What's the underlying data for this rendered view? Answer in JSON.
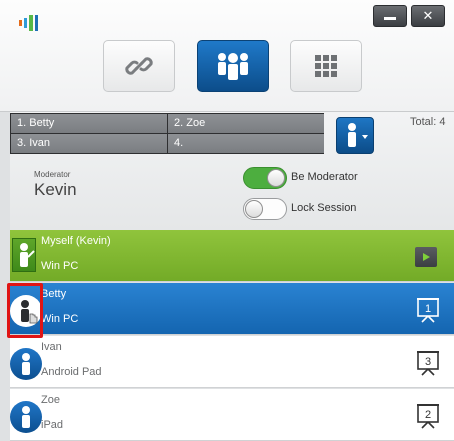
{
  "window": {
    "minimize_icon": "minimize-icon",
    "close_icon": "close-icon",
    "close_glyph": "✕"
  },
  "modes": [
    {
      "icon": "link-icon",
      "active": false
    },
    {
      "icon": "group-icon",
      "active": true
    },
    {
      "icon": "grid-icon",
      "active": false
    }
  ],
  "slots": [
    "1. Betty",
    "2. Zoe",
    "3. Ivan",
    "4."
  ],
  "total_label": "Total: 4",
  "moderator": {
    "caption": "Moderator",
    "name": "Kevin"
  },
  "toggles": [
    {
      "label": "Be Moderator",
      "on": true
    },
    {
      "label": "Lock Session",
      "on": false
    }
  ],
  "participants": [
    {
      "name": "Myself (Kevin)",
      "device": "Win PC",
      "style": "green",
      "action": "play",
      "icon": "moderator-icon"
    },
    {
      "name": "Betty",
      "device": "Win PC",
      "style": "blue",
      "screen_number": "1",
      "icon": "user-avatar-icon"
    },
    {
      "name": "Ivan",
      "device": "Android Pad",
      "style": "white",
      "screen_number": "3",
      "icon": "user-avatar-icon"
    },
    {
      "name": "Zoe",
      "device": "iPad",
      "style": "white",
      "screen_number": "2",
      "icon": "user-avatar-icon"
    }
  ],
  "colors": {
    "accent_blue": "#1565b0",
    "accent_green": "#7ab52e",
    "highlight_red": "#e01515"
  }
}
